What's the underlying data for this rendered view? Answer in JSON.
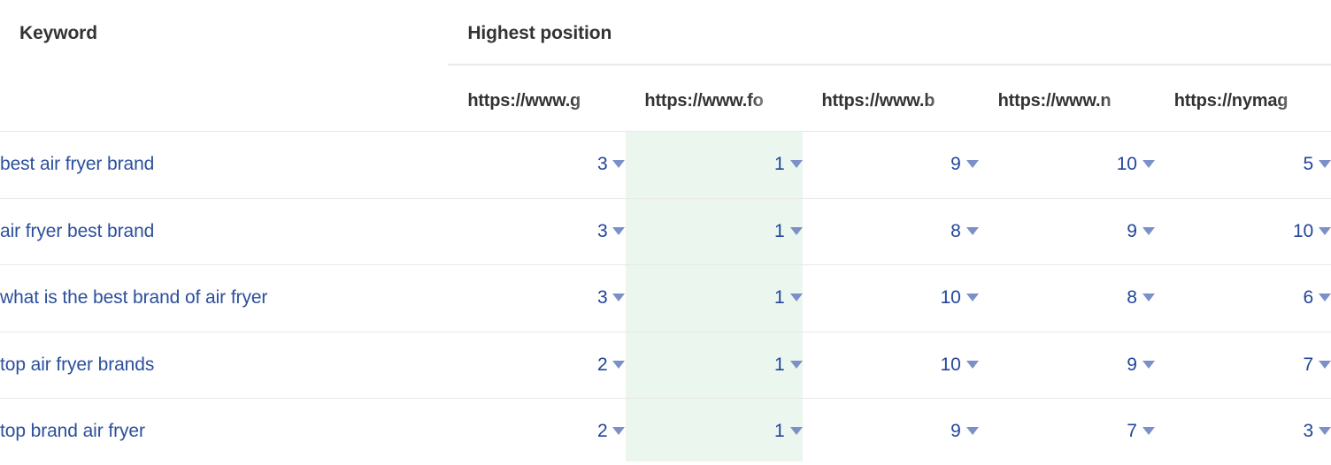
{
  "table": {
    "keyword_header": "Keyword",
    "group_header": "Highest position",
    "site_columns": [
      {
        "label": "https://www.g",
        "highlighted": false
      },
      {
        "label": "https://www.fo",
        "highlighted": true
      },
      {
        "label": "https://www.b",
        "highlighted": false
      },
      {
        "label": "https://www.n",
        "highlighted": false
      },
      {
        "label": "https://nymag",
        "highlighted": false
      }
    ],
    "rows": [
      {
        "keyword": "best air fryer brand",
        "positions": [
          "3",
          "1",
          "9",
          "10",
          "5"
        ]
      },
      {
        "keyword": "air fryer best brand",
        "positions": [
          "3",
          "1",
          "8",
          "9",
          "10"
        ]
      },
      {
        "keyword": "what is the best brand of air fryer",
        "positions": [
          "3",
          "1",
          "10",
          "8",
          "6"
        ]
      },
      {
        "keyword": "top air fryer brands",
        "positions": [
          "2",
          "1",
          "10",
          "9",
          "7"
        ]
      },
      {
        "keyword": "top brand air fryer",
        "positions": [
          "2",
          "1",
          "9",
          "7",
          "3"
        ]
      }
    ],
    "caret_icon": "chevron-down-icon"
  },
  "colors": {
    "link": "#2c4f9c",
    "value": "#21459b",
    "caret": "#7b8fc9",
    "header_text": "#333333",
    "highlight_column": "#eaf6ee",
    "divider": "#e8e8e8"
  }
}
